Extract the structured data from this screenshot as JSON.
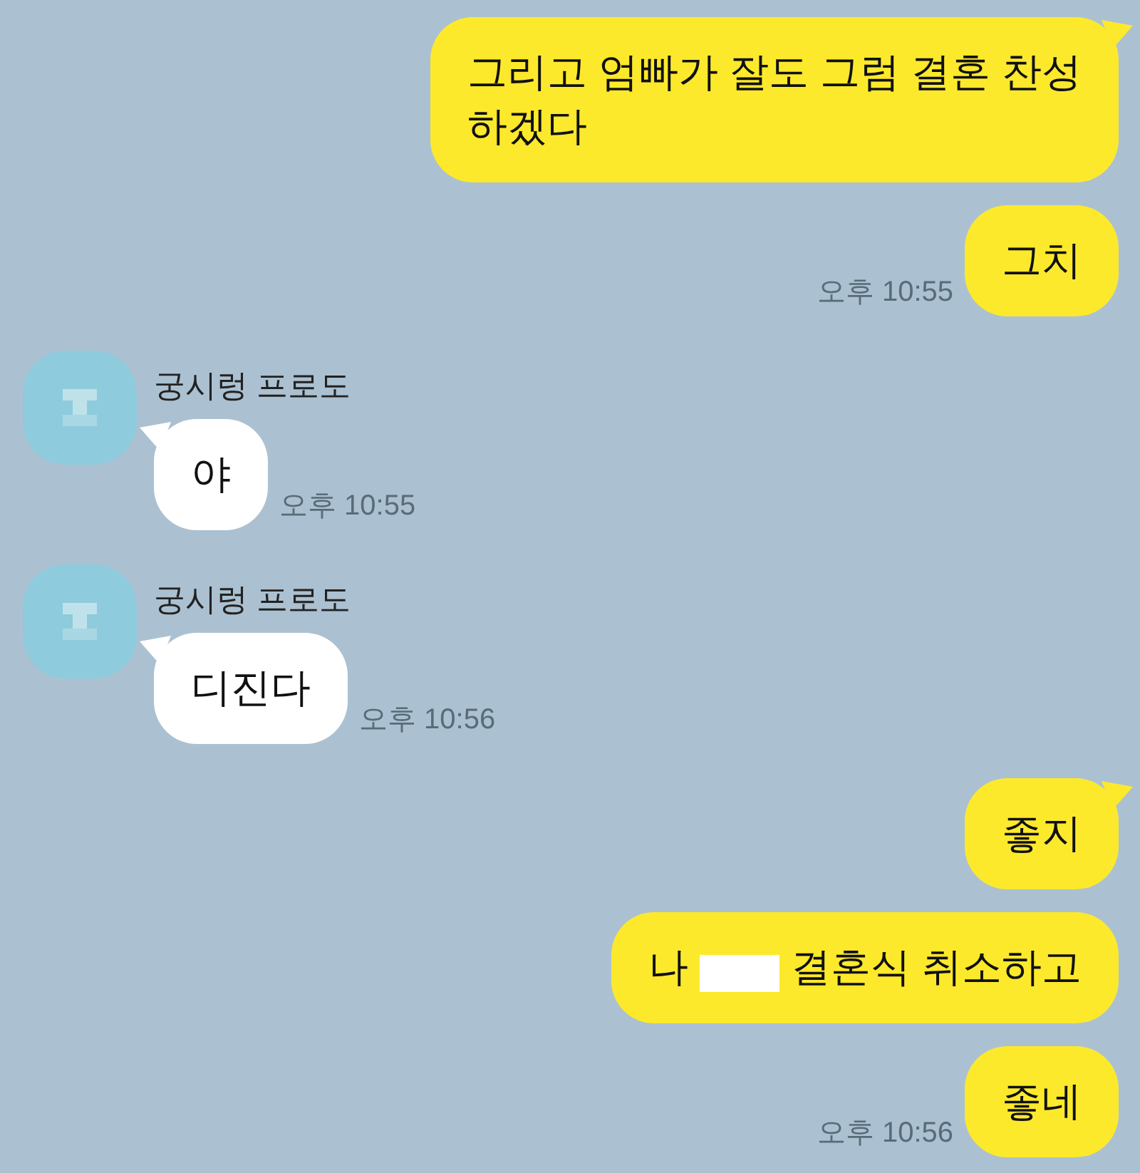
{
  "messages": [
    {
      "kind": "sent",
      "tail": true,
      "lines": [
        "그리고 엄빠가 잘도 그럼 결혼 찬성",
        "하겠다"
      ]
    },
    {
      "kind": "sent",
      "tail": false,
      "lines": [
        "그치"
      ],
      "time": "오후 10:55"
    },
    {
      "kind": "received",
      "tail": true,
      "sender": "궁시렁 프로도",
      "lines": [
        "야"
      ],
      "time": "오후 10:55"
    },
    {
      "kind": "received",
      "tail": true,
      "sender": "궁시렁 프로도",
      "lines": [
        "디진다"
      ],
      "time": "오후 10:56"
    },
    {
      "kind": "sent",
      "tail": true,
      "lines": [
        "좋지"
      ]
    },
    {
      "kind": "sent",
      "tail": false,
      "lines": [
        "나"
      ],
      "redacted": true,
      "after": "결혼식 취소하고"
    },
    {
      "kind": "sent",
      "tail": false,
      "lines": [
        "좋네"
      ],
      "time": "오후 10:56"
    }
  ]
}
